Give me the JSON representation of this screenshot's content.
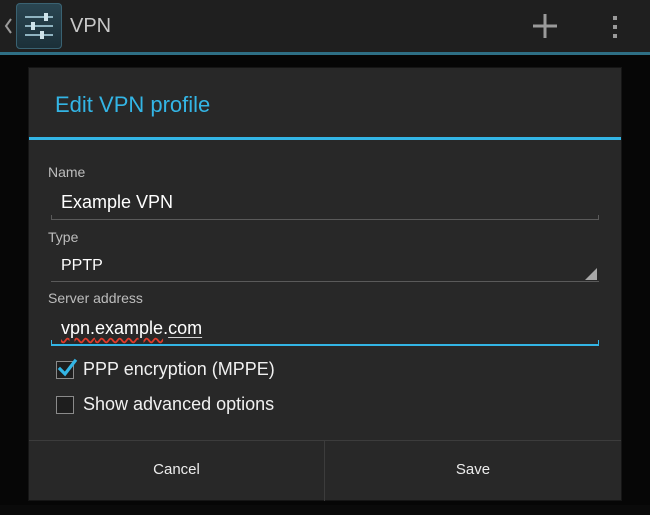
{
  "action_bar": {
    "title": "VPN",
    "up_icon": "chevron-left-icon",
    "app_icon": "settings-sliders-icon",
    "add_icon": "plus-icon",
    "overflow_icon": "overflow-menu-icon",
    "accent_color": "#33b5e5"
  },
  "dialog": {
    "title": "Edit VPN profile",
    "fields": {
      "name": {
        "label": "Name",
        "value": "Example VPN"
      },
      "type": {
        "label": "Type",
        "value": "PPTP"
      },
      "server": {
        "label": "Server address",
        "value_parts": [
          "vpn.",
          "example",
          ".",
          "com"
        ]
      }
    },
    "checkboxes": [
      {
        "label": "PPP encryption (MPPE)",
        "checked": true
      },
      {
        "label": "Show advanced options",
        "checked": false
      }
    ],
    "buttons": {
      "cancel": "Cancel",
      "save": "Save"
    }
  }
}
